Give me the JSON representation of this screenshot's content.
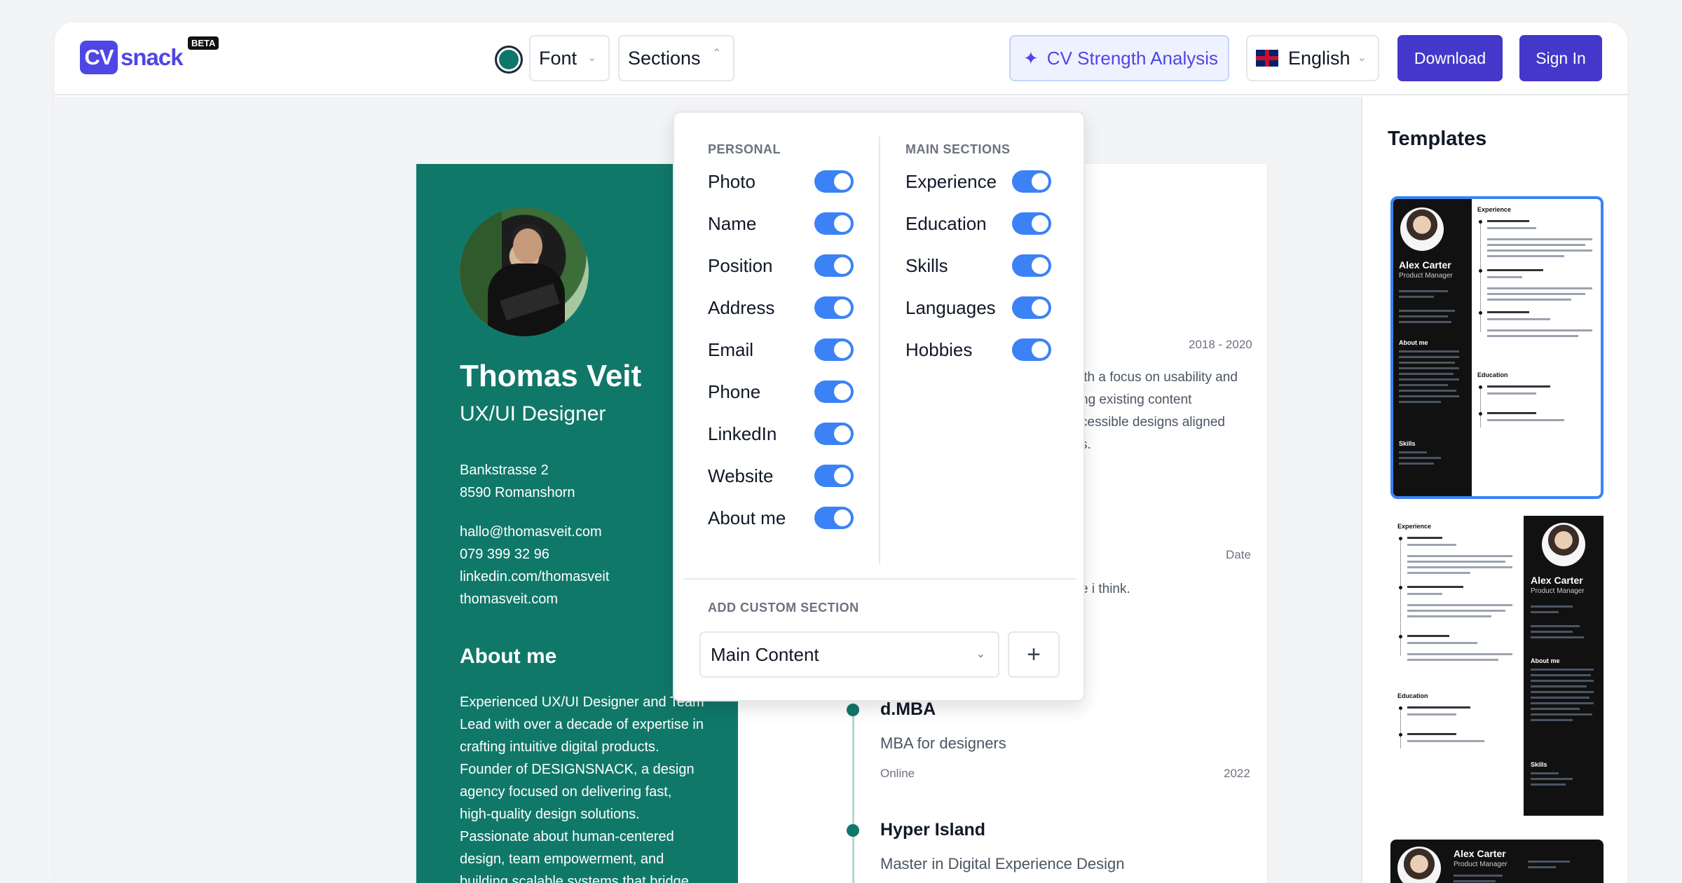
{
  "header": {
    "logo_box": "CV",
    "logo_text": "snack",
    "beta": "BETA",
    "accent_color": "#0e766a",
    "font_label": "Font",
    "sections_label": "Sections",
    "cv_strength_label": "CV Strength Analysis",
    "language_label": "English",
    "download_label": "Download",
    "signin_label": "Sign In"
  },
  "cv": {
    "name": "Thomas Veit",
    "role": "UX/UI Designer",
    "address_1": "Bankstrasse 2",
    "address_2": "8590 Romanshorn",
    "email": "hallo@thomasveit.com",
    "phone": "079 399 32 96",
    "linkedin": "linkedin.com/thomasveit",
    "website": "thomasveit.com",
    "about_heading": "About me",
    "about_text": "Experienced UX/UI Designer and Team Lead with over a decade of expertise in crafting intuitive digital products. Founder of DESIGNSNACK, a design agency focused on delivering fast, high-quality design solutions. Passionate about human-centered design, team empowerment, and building scalable systems that bridge business goals with user needs.",
    "exp_date": "2018 - 2020",
    "exp_text_1": "ith a focus on usability and",
    "exp_text_2": "ng existing content",
    "exp_text_3": "cessible designs aligned",
    "exp_text_4": "s.",
    "date_label": "Date",
    "think_text": "e i think.",
    "education": [
      {
        "title": "d.MBA",
        "subtitle": "MBA for designers",
        "location": "Online",
        "year": "2022"
      },
      {
        "title": "Hyper Island",
        "subtitle": "Master in Digital Experience Design",
        "location": "",
        "year": ""
      }
    ]
  },
  "sections_panel": {
    "personal_heading": "PERSONAL",
    "main_heading": "MAIN SECTIONS",
    "personal": [
      {
        "label": "Photo",
        "enabled": true
      },
      {
        "label": "Name",
        "enabled": true
      },
      {
        "label": "Position",
        "enabled": true
      },
      {
        "label": "Address",
        "enabled": true
      },
      {
        "label": "Email",
        "enabled": true
      },
      {
        "label": "Phone",
        "enabled": true
      },
      {
        "label": "LinkedIn",
        "enabled": true
      },
      {
        "label": "Website",
        "enabled": true
      },
      {
        "label": "About me",
        "enabled": true
      }
    ],
    "main": [
      {
        "label": "Experience",
        "enabled": true
      },
      {
        "label": "Education",
        "enabled": true
      },
      {
        "label": "Skills",
        "enabled": true
      },
      {
        "label": "Languages",
        "enabled": true
      },
      {
        "label": "Hobbies",
        "enabled": true
      }
    ],
    "custom_heading": "ADD CUSTOM SECTION",
    "custom_select_value": "Main Content",
    "add_symbol": "+"
  },
  "templates": {
    "title": "Templates",
    "sample_name": "Alex Carter",
    "sample_role": "Product Manager",
    "experience_head": "Experience",
    "about_head": "About me",
    "education_head": "Education",
    "skills_head": "Skills"
  }
}
